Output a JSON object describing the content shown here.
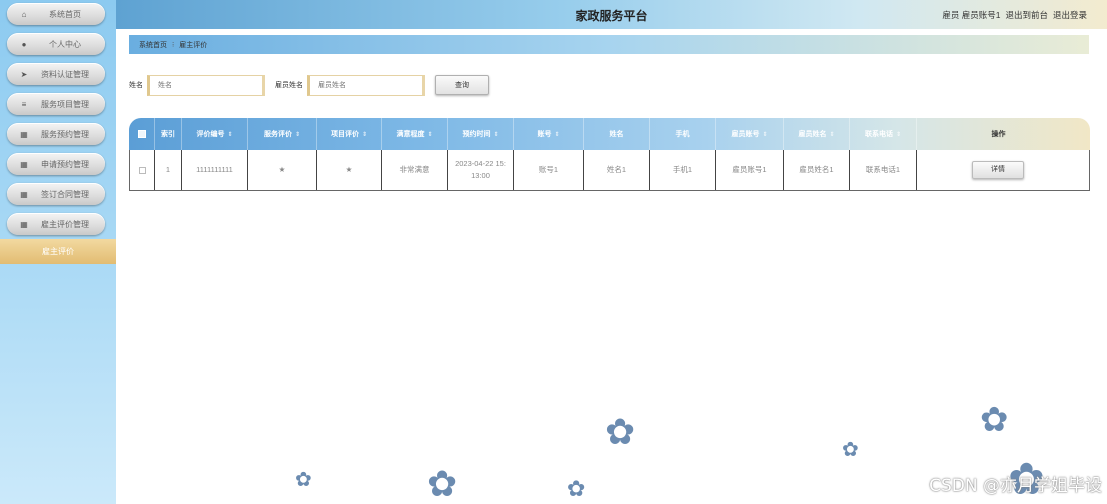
{
  "sidebar": {
    "items": [
      {
        "icon": "home-icon",
        "glyph": "⌂",
        "label": "系统首页"
      },
      {
        "icon": "user-icon",
        "glyph": "●",
        "label": "个人中心"
      },
      {
        "icon": "send-icon",
        "glyph": "➤",
        "label": "资料认证管理"
      },
      {
        "icon": "list-icon",
        "glyph": "≡",
        "label": "服务项目管理"
      },
      {
        "icon": "grid-icon",
        "glyph": "▦",
        "label": "服务预约管理"
      },
      {
        "icon": "grid-icon",
        "glyph": "▦",
        "label": "申请预约管理"
      },
      {
        "icon": "grid-icon",
        "glyph": "▦",
        "label": "签订合同管理"
      },
      {
        "icon": "grid-icon",
        "glyph": "▦",
        "label": "雇主评价管理"
      }
    ],
    "active_sub": "雇主评价"
  },
  "header": {
    "title": "家政服务平台",
    "user": "雇员 雇员账号1",
    "to_front": "退出到前台",
    "logout": "退出登录"
  },
  "breadcrumb": {
    "home": "系统首页",
    "separator": "⁝",
    "current": "雇主评价"
  },
  "search": {
    "name_label": "姓名",
    "name_placeholder": "姓名",
    "emp_label": "雇员姓名",
    "emp_placeholder": "雇员姓名",
    "button": "查询"
  },
  "table": {
    "headers": [
      "索引",
      "评价编号",
      "服务评价",
      "项目评价",
      "满意程度",
      "预约时间",
      "账号",
      "姓名",
      "手机",
      "雇员账号",
      "雇员姓名",
      "联系电话",
      "操作"
    ],
    "sortable": [
      false,
      true,
      true,
      true,
      true,
      true,
      true,
      false,
      false,
      true,
      true,
      true,
      false
    ],
    "rows": [
      {
        "index": "1",
        "code": "1111111111",
        "service_rating": "★",
        "project_rating": "★",
        "satisfaction": "非常满意",
        "time_line1": "2023-04-22 15:",
        "time_line2": "13:00",
        "account": "账号1",
        "name": "姓名1",
        "phone": "手机1",
        "emp_account": "雇员账号1",
        "emp_name": "雇员姓名1",
        "contact": "联系电话1",
        "action": "详情"
      }
    ]
  },
  "watermark": "CSDN @亦月学姐毕设",
  "colors": {
    "sidebar": "#a9d9f5",
    "active_sub": "#e2bc72",
    "header_left": "#5ea2d2",
    "header_right": "#f3ebcf"
  }
}
